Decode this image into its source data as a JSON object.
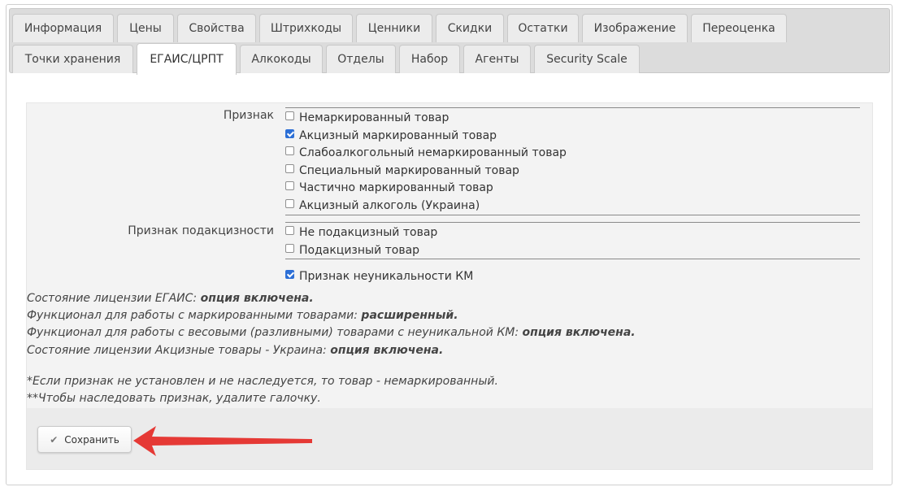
{
  "tabs_row1": [
    {
      "label": "Информация"
    },
    {
      "label": "Цены"
    },
    {
      "label": "Свойства"
    },
    {
      "label": "Штрихкоды"
    },
    {
      "label": "Ценники"
    },
    {
      "label": "Скидки"
    },
    {
      "label": "Остатки"
    },
    {
      "label": "Изображение"
    },
    {
      "label": "Переоценка"
    }
  ],
  "tabs_row2": [
    {
      "label": "Точки хранения"
    },
    {
      "label": "ЕГАИС/ЦРПТ",
      "active": true
    },
    {
      "label": "Алкокоды"
    },
    {
      "label": "Отделы"
    },
    {
      "label": "Набор"
    },
    {
      "label": "Агенты"
    },
    {
      "label": "Security Scale"
    }
  ],
  "sign": {
    "label": "Признак",
    "options": [
      {
        "label": "Немаркированный товар",
        "checked": false
      },
      {
        "label": "Акцизный маркированный товар",
        "checked": true
      },
      {
        "label": "Слабоалкогольный немаркированный товар",
        "checked": false
      },
      {
        "label": "Специальный маркированный товар",
        "checked": false
      },
      {
        "label": "Частично маркированный товар",
        "checked": false
      },
      {
        "label": "Акцизный алкоголь (Украина)",
        "checked": false
      }
    ]
  },
  "excise": {
    "label": "Признак подакцизности",
    "options": [
      {
        "label": "Не подакцизный товар",
        "checked": false
      },
      {
        "label": "Подакцизный товар",
        "checked": false
      }
    ]
  },
  "nonunique": {
    "label": "Признак неуникальности КМ",
    "checked": true
  },
  "info_lines": [
    {
      "text": "Состояние лицензии ЕГАИС: ",
      "value": "опция включена."
    },
    {
      "text": "Функционал для работы с маркированными товарами: ",
      "value": "расширенный."
    },
    {
      "text": "Функционал для работы с весовыми (разливными) товарами с неуникальной КМ: ",
      "value": "опция включена."
    },
    {
      "text": "Состояние лицензии Акцизные товары - Украина: ",
      "value": "опция включена."
    }
  ],
  "notes": [
    "*Если признак не установлен и не наследуется, то товар - немаркированный.",
    "**Чтобы наследовать признак, удалите галочку."
  ],
  "save_button": {
    "label": "Сохранить"
  },
  "colors": {
    "arrow": "#e53935",
    "checkbox_checked": "#2c6fd6"
  }
}
